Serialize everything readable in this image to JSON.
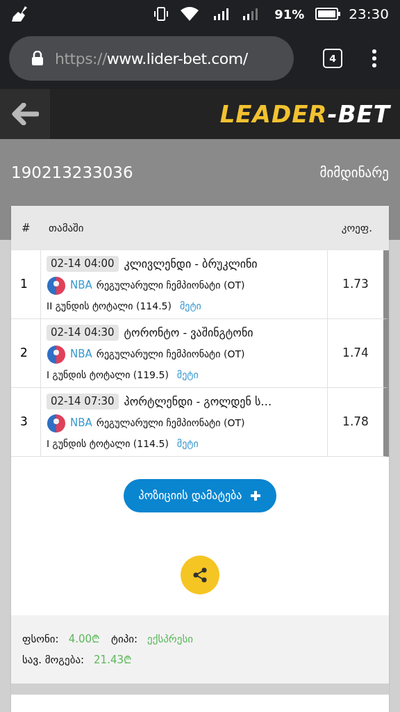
{
  "status_bar": {
    "battery": "91%",
    "time": "23:30"
  },
  "browser": {
    "url_scheme": "https://",
    "url_host": "www.lider-bet.com/",
    "tab_count": "4"
  },
  "header": {
    "logo_part_1": "LEADER",
    "logo_part_2": "-BET"
  },
  "ticket": {
    "id": "190213233036",
    "status": "მიმდინარე"
  },
  "table": {
    "columns": [
      "#",
      "თამაში",
      "კოეფ."
    ],
    "rows": [
      {
        "index": "1",
        "time": "02-14 04:00",
        "match": "კლივლენდი - ბრუკლინი",
        "league": "NBA",
        "tournament": "რეგულარული ჩემპიონატი (OT)",
        "market": "II გუნდის ტოტალი (114.5)",
        "pick": "მეტი",
        "odds": "1.73"
      },
      {
        "index": "2",
        "time": "02-14 04:30",
        "match": "ტორონტო - ვაშინგტონი",
        "league": "NBA",
        "tournament": "რეგულარული ჩემპიონატი (OT)",
        "market": "I გუნდის ტოტალი (119.5)",
        "pick": "მეტი",
        "odds": "1.74"
      },
      {
        "index": "3",
        "time": "02-14 07:30",
        "match": "პორტლენდი - გოლდენ ს…",
        "league": "NBA",
        "tournament": "რეგულარული ჩემპიონატი (OT)",
        "market": "I გუნდის ტოტალი (114.5)",
        "pick": "მეტი",
        "odds": "1.78"
      }
    ]
  },
  "add_button": {
    "label": "პოზიციის დამატება"
  },
  "summary": {
    "stake_label": "ფსონი:",
    "stake": "4.00₾",
    "type_label": "ტიპი:",
    "type": "ექსპრესი",
    "win_label": "სავ. მოგება:",
    "win": "21.43₾"
  }
}
